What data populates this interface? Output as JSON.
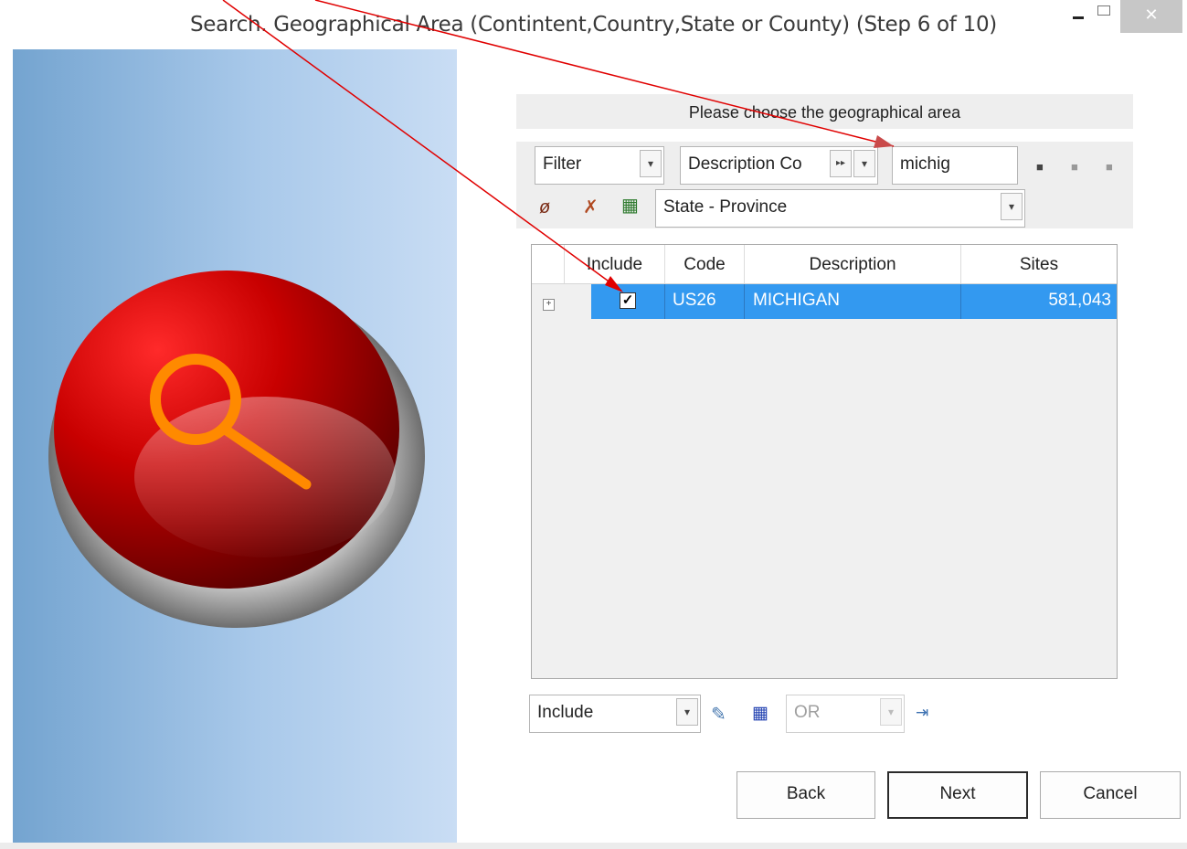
{
  "window": {
    "title": "Search.  Geographical Area (Contintent,Country,State or County) (Step 6 of 10)",
    "close_glyph": "✕"
  },
  "header": {
    "text": "Please choose the geographical area"
  },
  "filter": {
    "mode": "Filter",
    "field": "Description Co",
    "search_value": "michig",
    "level": "State - Province"
  },
  "grid": {
    "columns": [
      "Include",
      "Code",
      "Description",
      "Sites"
    ],
    "rows": [
      {
        "include": true,
        "code": "US26",
        "description": "MICHIGAN",
        "sites": "581,043"
      }
    ]
  },
  "bottom": {
    "include_mode": "Include",
    "operator": "OR"
  },
  "buttons": {
    "back": "Back",
    "next": "Next",
    "cancel": "Cancel"
  },
  "colors": {
    "selection": "#3399f0",
    "arrow": "#e00000",
    "button_red": "#c00000",
    "magnifier": "#ff8a00"
  }
}
